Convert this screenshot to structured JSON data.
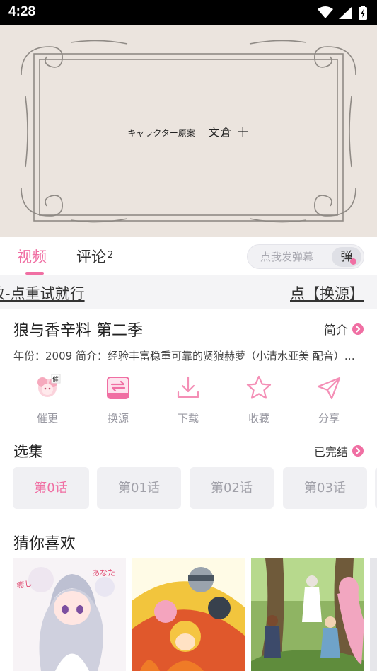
{
  "status_bar": {
    "time": "4:28"
  },
  "video": {
    "caption_a": "キャラクター原案",
    "caption_b": "文倉 十"
  },
  "tabs": {
    "video": "视频",
    "comments": "评论",
    "comments_count": "2"
  },
  "danmaku": {
    "placeholder": "点我发弹幕",
    "button": "弹"
  },
  "marquee": {
    "left": "败-点重试就行",
    "right": "点【换源】"
  },
  "anime": {
    "title": "狼与香辛料 第二季",
    "intro_link": "简介",
    "meta": "年份：2009  简介：经验丰富稳重可靠的贤狼赫萝（小清水亚美 配音）与旅行商人罗伦斯继续旅行"
  },
  "actions": [
    {
      "label": "催更",
      "icon": "mascot-icon"
    },
    {
      "label": "换源",
      "icon": "switch-source-icon"
    },
    {
      "label": "下载",
      "icon": "download-icon"
    },
    {
      "label": "收藏",
      "icon": "star-icon"
    },
    {
      "label": "分享",
      "icon": "share-icon"
    }
  ],
  "episodes": {
    "title": "选集",
    "status": "已完结",
    "items": [
      "第0话",
      "第01话",
      "第02话",
      "第03话"
    ]
  },
  "recommend": {
    "title": "猜你喜欢"
  },
  "colors": {
    "accent": "#f06fa3",
    "muted": "#9a9aa3"
  }
}
